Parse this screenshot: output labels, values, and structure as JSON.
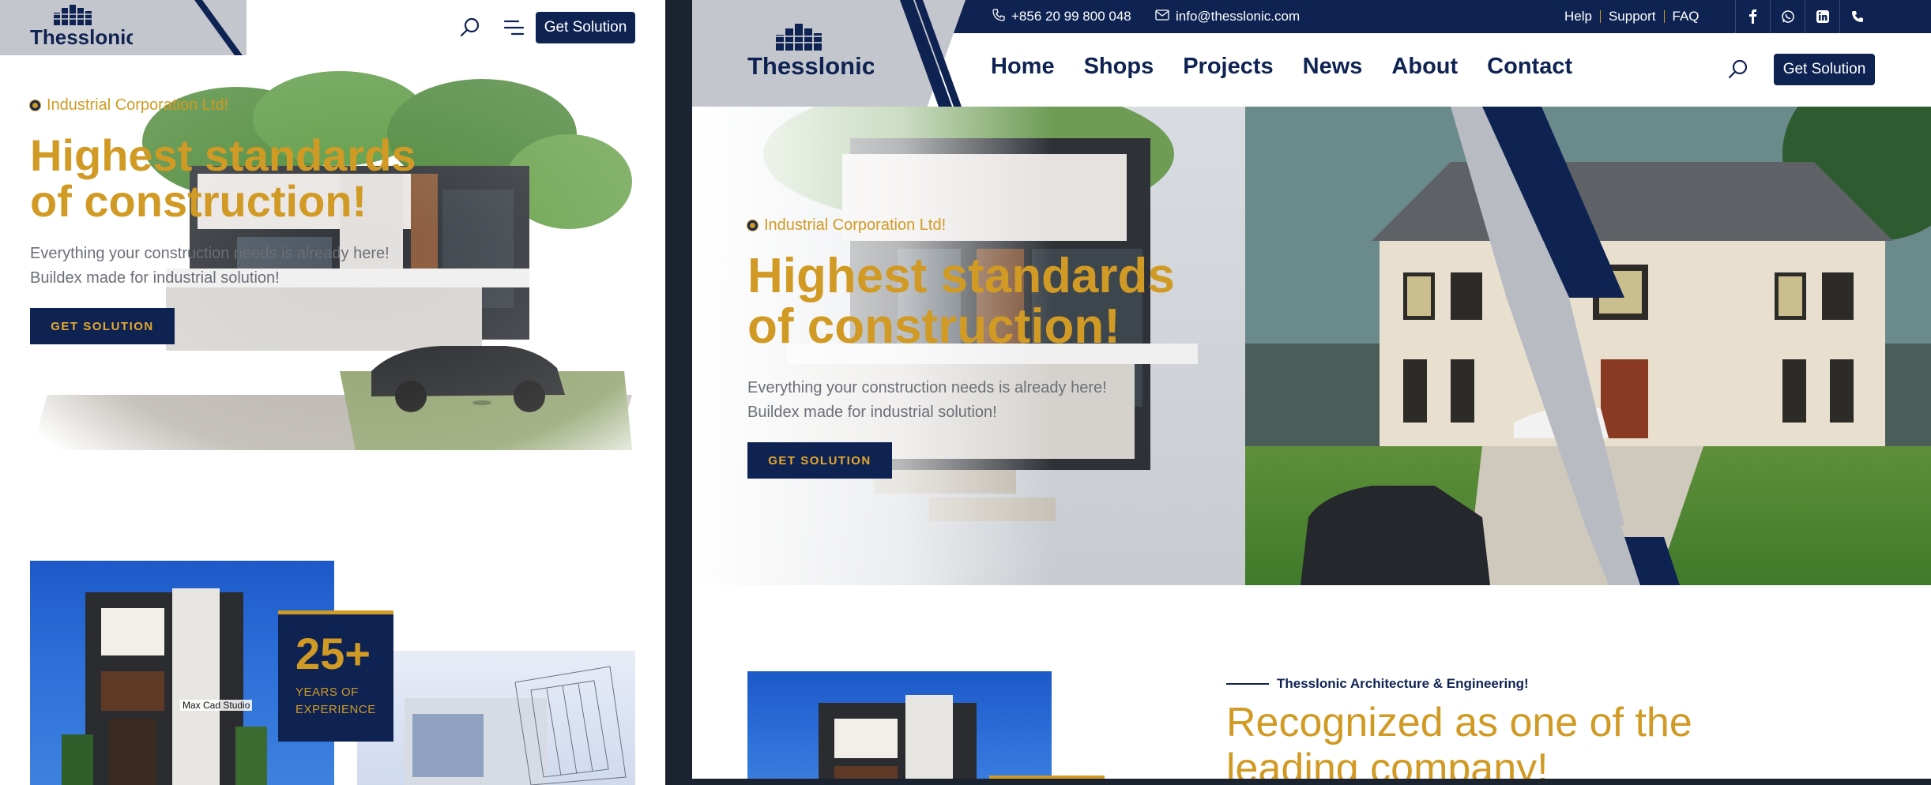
{
  "brand": {
    "name": "Thesslonic",
    "navy": "#0f2353",
    "gold": "#d19a24",
    "grey": "#c3c6cc"
  },
  "mobile": {
    "header": {
      "get_solution_label": "Get Solution"
    },
    "hero": {
      "tag": "Industrial Corporation Ltd!",
      "title_line1": "Highest standards",
      "title_line2": "of construction!",
      "subtitle_line1": "Everything your construction needs is already here!",
      "subtitle_line2": "Buildex made for industrial solution!",
      "button_label": "GET SOLUTION"
    },
    "about": {
      "experience_number": "25+",
      "experience_line1": "YEARS OF",
      "experience_line2": "EXPERIENCE",
      "image_caption": "Max Cad Studio"
    }
  },
  "desktop": {
    "topbar": {
      "phone": "+856 20 99 800 048",
      "email": "info@thesslonic.com",
      "links": [
        "Help",
        "Support",
        "FAQ"
      ],
      "social_icons": [
        "facebook-icon",
        "whatsapp-icon",
        "linkedin-icon",
        "phone-icon"
      ]
    },
    "nav": {
      "items": [
        "Home",
        "Shops",
        "Projects",
        "News",
        "About",
        "Contact"
      ],
      "get_solution_label": "Get Solution"
    },
    "hero": {
      "tag": "Industrial Corporation Ltd!",
      "title_line1": "Highest standards",
      "title_line2": "of construction!",
      "subtitle_line1": "Everything your construction needs is already here!",
      "subtitle_line2": "Buildex made for industrial solution!",
      "button_label": "GET SOLUTION"
    },
    "about": {
      "subtag": "Thesslonic Architecture & Engineering!",
      "title_line1": "Recognized as one of the",
      "title_line2": "leading company!"
    }
  }
}
